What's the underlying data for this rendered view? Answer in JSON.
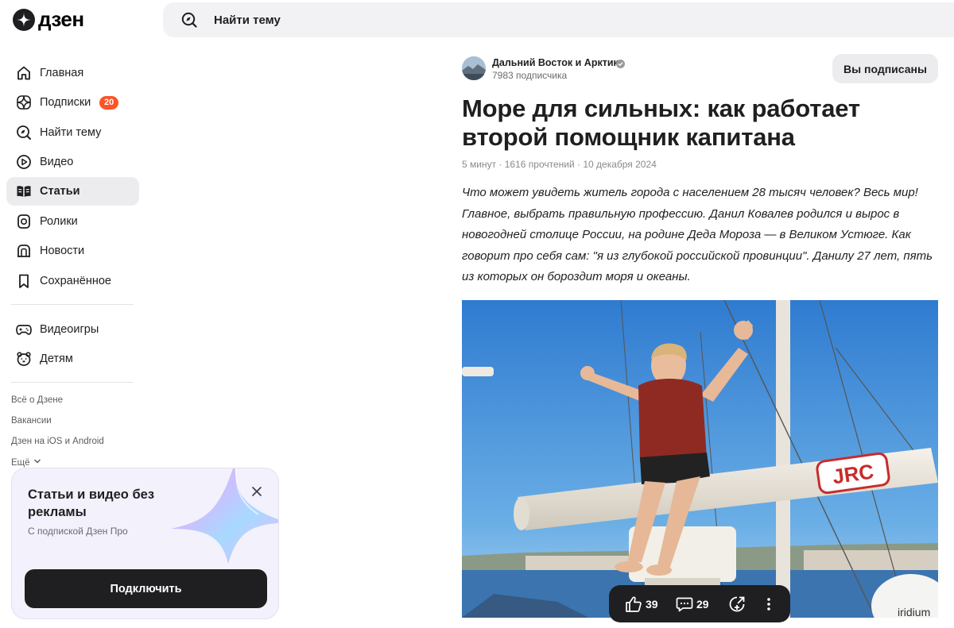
{
  "header": {
    "logo_text": "дзен",
    "search": {
      "placeholder": "Найти тему"
    }
  },
  "sidebar": {
    "items": [
      {
        "label": "Главная",
        "icon": "home-icon"
      },
      {
        "label": "Подписки",
        "icon": "subscriptions-icon",
        "badge": "20"
      },
      {
        "label": "Найти тему",
        "icon": "compass-icon"
      },
      {
        "label": "Видео",
        "icon": "play-icon"
      },
      {
        "label": "Статьи",
        "icon": "articles-icon",
        "active": true
      },
      {
        "label": "Ролики",
        "icon": "shorts-icon"
      },
      {
        "label": "Новости",
        "icon": "news-icon"
      },
      {
        "label": "Сохранённое",
        "icon": "bookmark-icon"
      }
    ],
    "secondary_items": [
      {
        "label": "Видеоигры",
        "icon": "gamepad-icon"
      },
      {
        "label": "Детям",
        "icon": "kids-bear-icon"
      }
    ],
    "footer_links": [
      "Всё о Дзене",
      "Вакансии",
      "Дзен на iOS и Android",
      "Ещё"
    ]
  },
  "promo": {
    "title": "Статьи и видео без рекламы",
    "subtitle": "С подпиской Дзен Про",
    "button_label": "Подключить"
  },
  "channel": {
    "name": "Дальний Восток и Арктика",
    "subscribers": "7983 подписчика",
    "subscribe_button": "Вы подписаны"
  },
  "article": {
    "title": "Море для сильных: как работает второй помощник капитана",
    "meta": "5 минут · 1616 прочтений · 10 декабря 2024",
    "lead": "Что может увидеть житель города с населением 28 тысяч человек? Весь мир! Главное, выбрать правильную профессию. Данил Ковалев родился и вырос в новогодней столице России, на родине Деда Мороза — в Великом Устюге. Как говорит про себя сам: \"я из глубокой российской провинции\". Данилу 27 лет, пять из которых он бороздит моря и океаны.",
    "photo_labels": {
      "radar_brand": "JRC",
      "dome_text": "iridium"
    }
  },
  "reactions": {
    "likes": "39",
    "comments": "29"
  },
  "colors": {
    "accent": "#ff5326",
    "dark": "#1f1f21",
    "active_bg": "#ececef",
    "search_bg": "#f2f2f4",
    "sky": "#4a8fd4"
  }
}
